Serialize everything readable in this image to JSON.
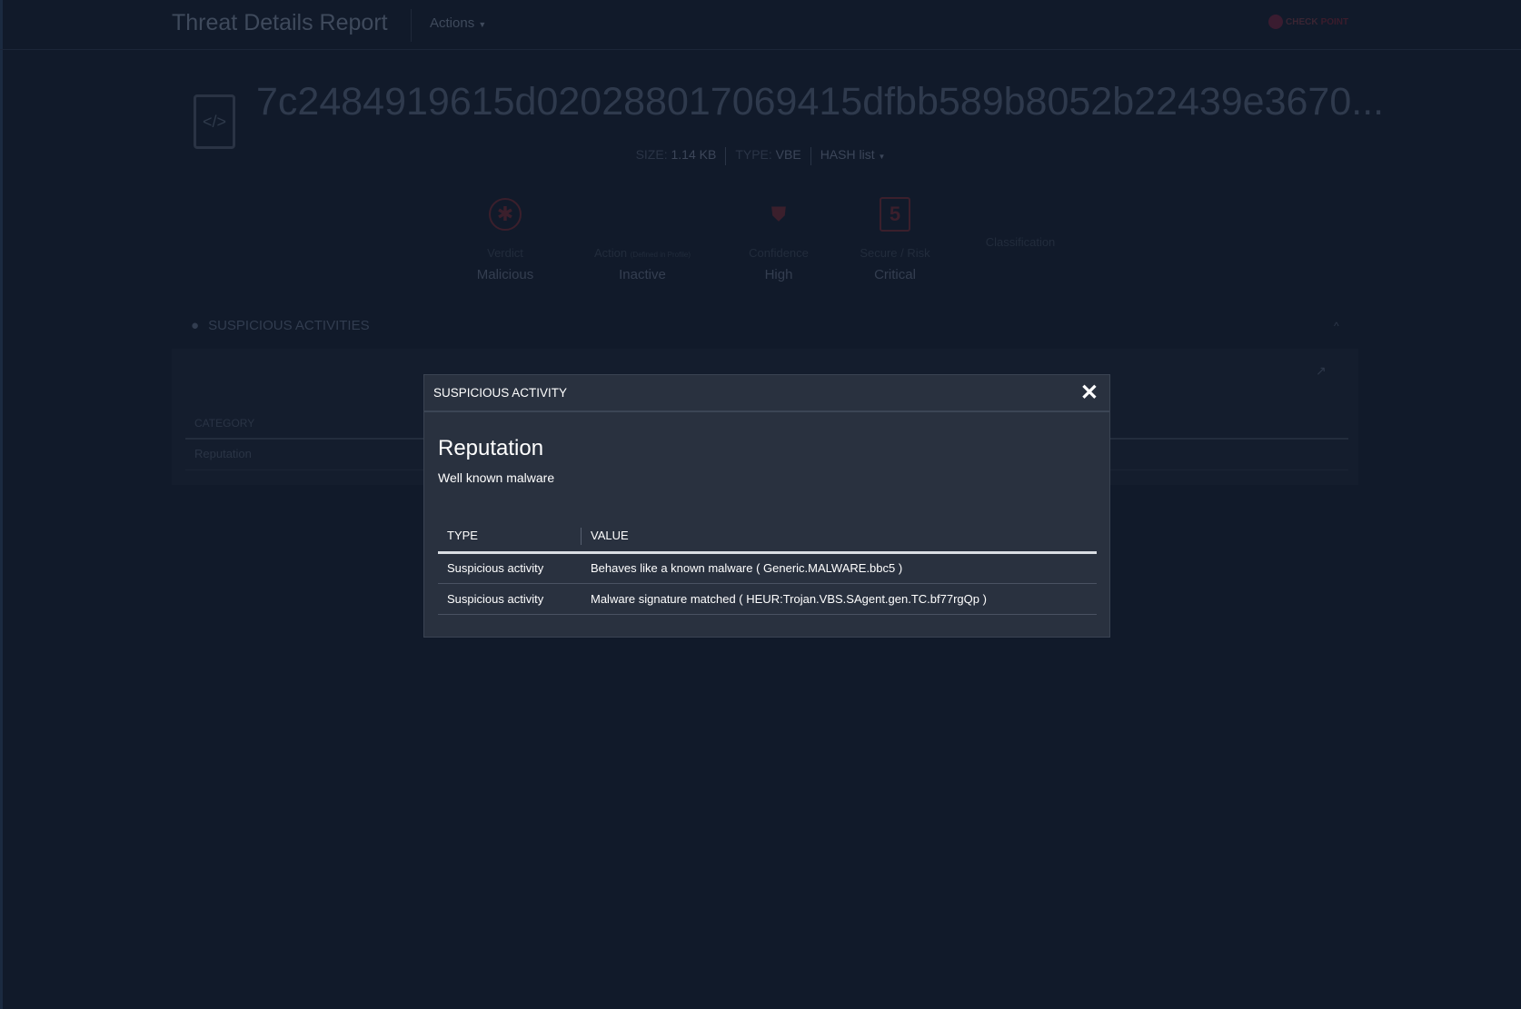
{
  "header": {
    "title": "Threat Details Report",
    "actions_label": "Actions",
    "logo_text_1": "CHECK",
    "logo_text_2": "POINT"
  },
  "file": {
    "hash": "7c2484919615d020288017069415dfbb589b8052b22439e3670...",
    "size_label": "SIZE:",
    "size": "1.14 KB",
    "type_label": "TYPE:",
    "type": "VBE",
    "hash_list_label": "HASH list"
  },
  "stats": [
    {
      "label": "Verdict",
      "value": "Malicious"
    },
    {
      "label": "Action",
      "note": "(Defined in Profile)",
      "value": "Inactive"
    },
    {
      "label": "Confidence",
      "value": "High"
    },
    {
      "label": "Secure / Risk",
      "value": "Critical",
      "score": "5"
    },
    {
      "label": "Classification"
    }
  ],
  "section": {
    "title": "SUSPICIOUS ACTIVITIES",
    "column": "CATEGORY",
    "row": "Reputation"
  },
  "modal": {
    "title": "SUSPICIOUS ACTIVITY",
    "heading": "Reputation",
    "subtitle": "Well known malware",
    "columns": [
      "TYPE",
      "VALUE"
    ],
    "rows": [
      [
        "Suspicious activity",
        "Behaves like a known malware ( Generic.MALWARE.bbc5 )"
      ],
      [
        "Suspicious activity",
        "Malware signature matched ( HEUR:Trojan.VBS.SAgent.gen.TC.bf77rgQp )"
      ]
    ]
  }
}
